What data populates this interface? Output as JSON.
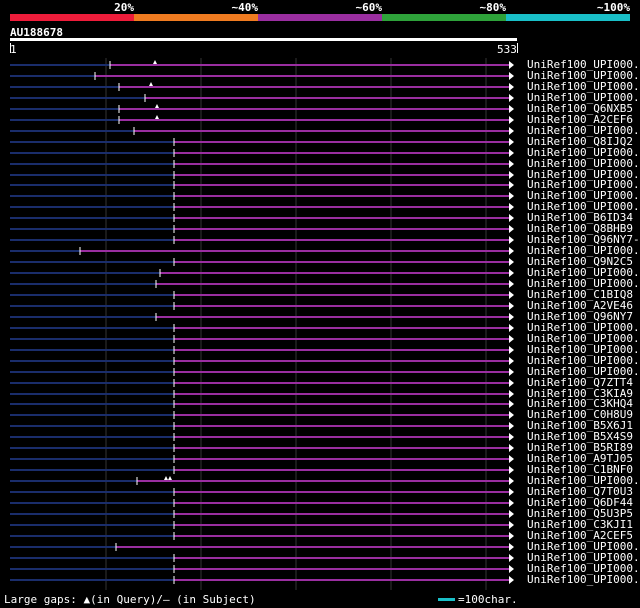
{
  "header": {
    "percent_labels": [
      "20%",
      "~40%",
      "~60%",
      "~80%",
      "~100%"
    ],
    "identity_colors": [
      "#ee1c3a",
      "#ef7b20",
      "#9a2ea0",
      "#2ea23a",
      "#19bfc8"
    ]
  },
  "query": {
    "id": "AU188678",
    "start": "1",
    "end": "533"
  },
  "colors": {
    "hit_line": "#9a2ea0",
    "unaligned_line": "#1a2d6b",
    "grid": "#333333"
  },
  "hits": [
    {
      "label": "UniRef100_UPI000..",
      "start": 100,
      "gaps": [
        25
      ]
    },
    {
      "label": "UniRef100_UPI000..",
      "start": 85,
      "gaps": []
    },
    {
      "label": "UniRef100_UPI000..",
      "start": 109,
      "gaps": [
        12
      ]
    },
    {
      "label": "UniRef100_UPI000..",
      "start": 135,
      "gaps": []
    },
    {
      "label": "UniRef100_Q6NXB5",
      "start": 109,
      "gaps": [
        18
      ]
    },
    {
      "label": "UniRef100_A2CEF6",
      "start": 109,
      "gaps": [
        18
      ]
    },
    {
      "label": "UniRef100_UPI000..",
      "start": 124,
      "gaps": []
    },
    {
      "label": "UniRef100_Q8IJQ2",
      "start": 164,
      "gaps": []
    },
    {
      "label": "UniRef100_UPI000..",
      "start": 164,
      "gaps": []
    },
    {
      "label": "UniRef100_UPI000..",
      "start": 164,
      "gaps": []
    },
    {
      "label": "UniRef100_UPI000..",
      "start": 164,
      "gaps": []
    },
    {
      "label": "UniRef100_UPI000..",
      "start": 164,
      "gaps": []
    },
    {
      "label": "UniRef100_UPI000..",
      "start": 164,
      "gaps": []
    },
    {
      "label": "UniRef100_UPI000..",
      "start": 164,
      "gaps": []
    },
    {
      "label": "UniRef100_B6ID34",
      "start": 164,
      "gaps": []
    },
    {
      "label": "UniRef100_Q8BHB9",
      "start": 164,
      "gaps": []
    },
    {
      "label": "UniRef100_Q96NY7-2",
      "start": 164,
      "gaps": []
    },
    {
      "label": "UniRef100_UPI000..",
      "start": 70,
      "gaps": []
    },
    {
      "label": "UniRef100_Q9N2C5",
      "start": 164,
      "gaps": []
    },
    {
      "label": "UniRef100_UPI000..",
      "start": 150,
      "gaps": []
    },
    {
      "label": "UniRef100_UPI000..",
      "start": 146,
      "gaps": []
    },
    {
      "label": "UniRef100_C1BIQ8",
      "start": 164,
      "gaps": []
    },
    {
      "label": "UniRef100_A2VE46",
      "start": 164,
      "gaps": []
    },
    {
      "label": "UniRef100_Q96NY7",
      "start": 146,
      "gaps": []
    },
    {
      "label": "UniRef100_UPI000..",
      "start": 164,
      "gaps": []
    },
    {
      "label": "UniRef100_UPI000..",
      "start": 164,
      "gaps": []
    },
    {
      "label": "UniRef100_UPI000..",
      "start": 164,
      "gaps": []
    },
    {
      "label": "UniRef100_UPI000..",
      "start": 164,
      "gaps": []
    },
    {
      "label": "UniRef100_UPI000..",
      "start": 164,
      "gaps": []
    },
    {
      "label": "UniRef100_Q7ZTT4",
      "start": 164,
      "gaps": []
    },
    {
      "label": "UniRef100_C3KIA9",
      "start": 164,
      "gaps": []
    },
    {
      "label": "UniRef100_C3KHQ4",
      "start": 164,
      "gaps": []
    },
    {
      "label": "UniRef100_C0H8U9",
      "start": 164,
      "gaps": []
    },
    {
      "label": "UniRef100_B5X6J1",
      "start": 164,
      "gaps": []
    },
    {
      "label": "UniRef100_B5X4S9",
      "start": 164,
      "gaps": []
    },
    {
      "label": "UniRef100_B5RI89",
      "start": 164,
      "gaps": []
    },
    {
      "label": "UniRef100_A9TJ05",
      "start": 164,
      "gaps": []
    },
    {
      "label": "UniRef100_C1BNF0",
      "start": 164,
      "gaps": []
    },
    {
      "label": "UniRef100_UPI000..",
      "start": 127,
      "gaps": [
        9,
        13
      ]
    },
    {
      "label": "UniRef100_Q7T0U3",
      "start": 164,
      "gaps": []
    },
    {
      "label": "UniRef100_Q6DF44",
      "start": 164,
      "gaps": []
    },
    {
      "label": "UniRef100_Q5U3P5",
      "start": 164,
      "gaps": []
    },
    {
      "label": "UniRef100_C3KJI1",
      "start": 164,
      "gaps": []
    },
    {
      "label": "UniRef100_A2CEF5",
      "start": 164,
      "gaps": []
    },
    {
      "label": "UniRef100_UPI000..",
      "start": 106,
      "gaps": []
    },
    {
      "label": "UniRef100_UPI000..",
      "start": 164,
      "gaps": []
    },
    {
      "label": "UniRef100_UPI000..",
      "start": 164,
      "gaps": []
    },
    {
      "label": "UniRef100_UPI000..",
      "start": 164,
      "gaps": []
    }
  ],
  "footer": {
    "gaps_legend": "Large gaps: ▲(in Query)/– (in Subject)",
    "scale_text": "=100char."
  }
}
